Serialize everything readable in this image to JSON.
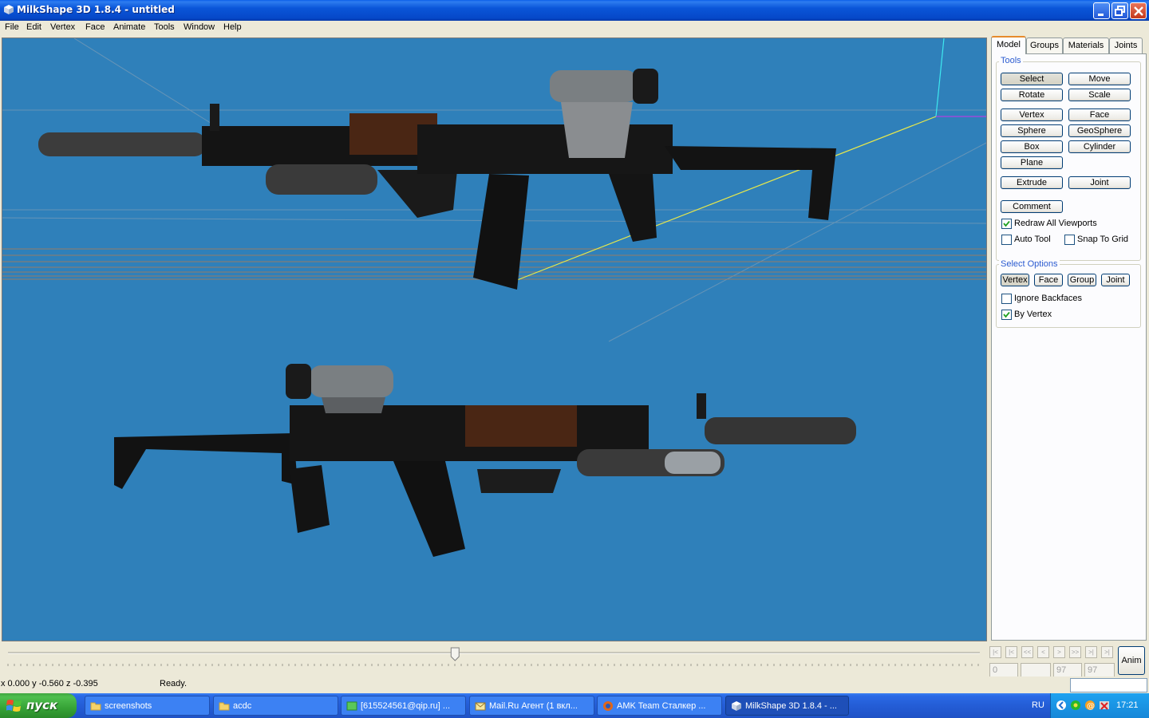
{
  "window": {
    "title": "MilkShape 3D 1.8.4 - untitled",
    "app_icon": "milkshape-cube-icon",
    "controls": [
      "minimize-icon",
      "restore-icon",
      "close-icon"
    ]
  },
  "menu": [
    "File",
    "Edit",
    "Vertex",
    "Face",
    "Animate",
    "Tools",
    "Window",
    "Help"
  ],
  "panel": {
    "tabs": [
      "Model",
      "Groups",
      "Materials",
      "Joints"
    ],
    "active_tab": "Model",
    "tools_label": "Tools",
    "tool_buttons": {
      "select": "Select",
      "move": "Move",
      "rotate": "Rotate",
      "scale": "Scale",
      "vertex": "Vertex",
      "face": "Face",
      "sphere": "Sphere",
      "geosphere": "GeoSphere",
      "box": "Box",
      "cylinder": "Cylinder",
      "plane": "Plane",
      "extrude": "Extrude",
      "joint": "Joint",
      "comment": "Comment"
    },
    "options": {
      "redraw_all": {
        "label": "Redraw All Viewports",
        "checked": true
      },
      "auto_tool": {
        "label": "Auto Tool",
        "checked": false
      },
      "snap_grid": {
        "label": "Snap To Grid",
        "checked": false
      }
    },
    "select_options": {
      "label": "Select Options",
      "buttons": {
        "vertex": "Vertex",
        "face": "Face",
        "group": "Group",
        "joint": "Joint"
      },
      "ignore_backfaces": {
        "label": "Ignore Backfaces",
        "checked": false
      },
      "by_vertex": {
        "label": "By Vertex",
        "checked": true
      }
    }
  },
  "timeline": {
    "slider_position": 0.46,
    "nav_icons": [
      "first-frame-icon",
      "prev-key-icon",
      "rewind-icon",
      "prev-frame-icon",
      "next-frame-icon",
      "fast-forward-icon",
      "next-key-icon",
      "last-frame-icon"
    ],
    "fields": {
      "current": "0",
      "blank": "",
      "start": "97",
      "end": "97"
    },
    "anim_label": "Anim"
  },
  "status": {
    "coords": "x 0.000 y -0.560 z -0.395",
    "message": "Ready."
  },
  "taskbar": {
    "start": "пуск",
    "tasks": {
      "t1": "screenshots",
      "t2": "acdc",
      "t3": "[615524561@qip.ru] ...",
      "t4": "Mail.Ru Агент (1 вкл...",
      "t5": "AMK Team Сталкер ...",
      "t6": "MilkShape 3D 1.8.4 - ..."
    },
    "language": "RU",
    "clock": "17:21"
  },
  "colors": {
    "viewport_bg": "#2f80ba",
    "title_blue": "#0a55d8",
    "taskbar_blue": "#245dd6",
    "start_green": "#36a336"
  }
}
